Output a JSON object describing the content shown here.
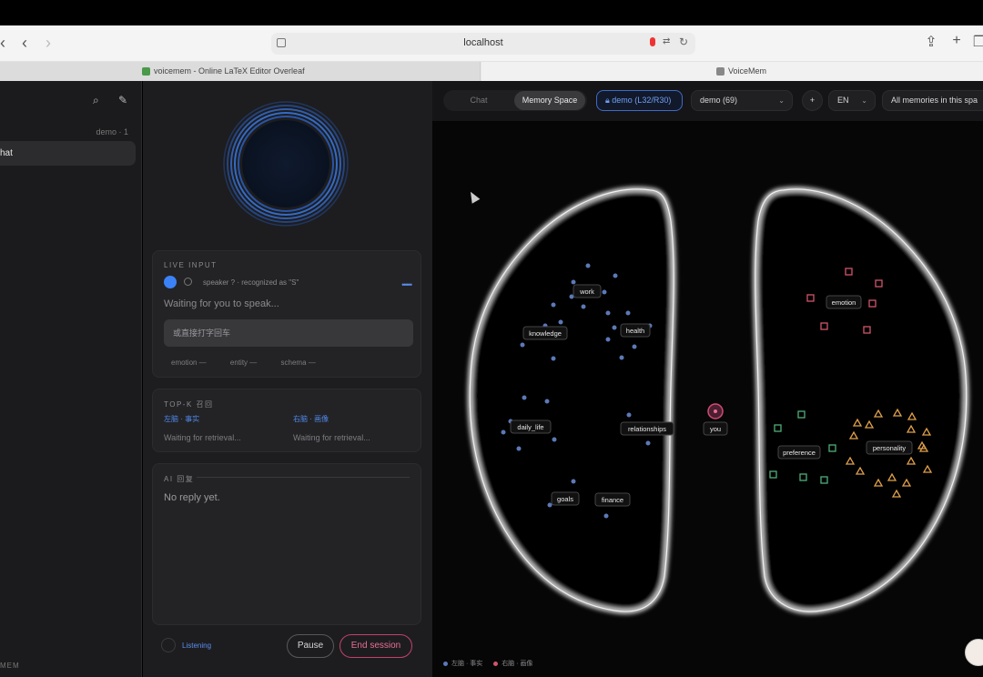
{
  "browser": {
    "address": "localhost",
    "tabs": [
      {
        "label": "voicemem - Online LaTeX Editor Overleaf"
      },
      {
        "label": "VoiceMem"
      }
    ]
  },
  "sidebar": {
    "meta": "demo · 1",
    "active_item": "hat",
    "footer": "MEM"
  },
  "live_input": {
    "header": "LIVE INPUT",
    "speaker": "speaker ? · recognized as \"S\"",
    "status": "Waiting for you to speak...",
    "placeholder": "或直接打字回车",
    "tags": [
      "emotion —",
      "entity —",
      "schema —"
    ]
  },
  "topk": {
    "header": "TOP-K 召回",
    "left_title": "左脑 · 事实",
    "right_title": "右脑 · 画像",
    "left_status": "Waiting for retrieval...",
    "right_status": "Waiting for retrieval..."
  },
  "ai_reply": {
    "header": "AI 回复",
    "text": "No reply yet."
  },
  "controls": {
    "listening": "Listening",
    "pause": "Pause",
    "end": "End session"
  },
  "memory_toolbar": {
    "chat": "Chat",
    "memory_space": "Memory Space",
    "layer": "demo (L32/R30)",
    "dataset": "demo (69)",
    "add": "+",
    "lang": "EN",
    "scope": "All memories in this spa"
  },
  "graph": {
    "clusters": [
      {
        "label": "work",
        "hemisphere": "left"
      },
      {
        "label": "knowledge",
        "hemisphere": "left"
      },
      {
        "label": "health",
        "hemisphere": "left"
      },
      {
        "label": "daily_life",
        "hemisphere": "left"
      },
      {
        "label": "relationships",
        "hemisphere": "left"
      },
      {
        "label": "goals",
        "hemisphere": "left"
      },
      {
        "label": "finance",
        "hemisphere": "left"
      },
      {
        "label": "emotion",
        "hemisphere": "right"
      },
      {
        "label": "preference",
        "hemisphere": "right"
      },
      {
        "label": "personality",
        "hemisphere": "right"
      }
    ],
    "center_label": "you",
    "legend_left": "左脑 · 事实",
    "legend_right": "右脑 · 画像",
    "colors": {
      "left_node": "#5b79b8",
      "emotion": "#d0556c",
      "preference": "#4fae78",
      "personality": "#e0a04a",
      "you": "#d24a78"
    }
  }
}
